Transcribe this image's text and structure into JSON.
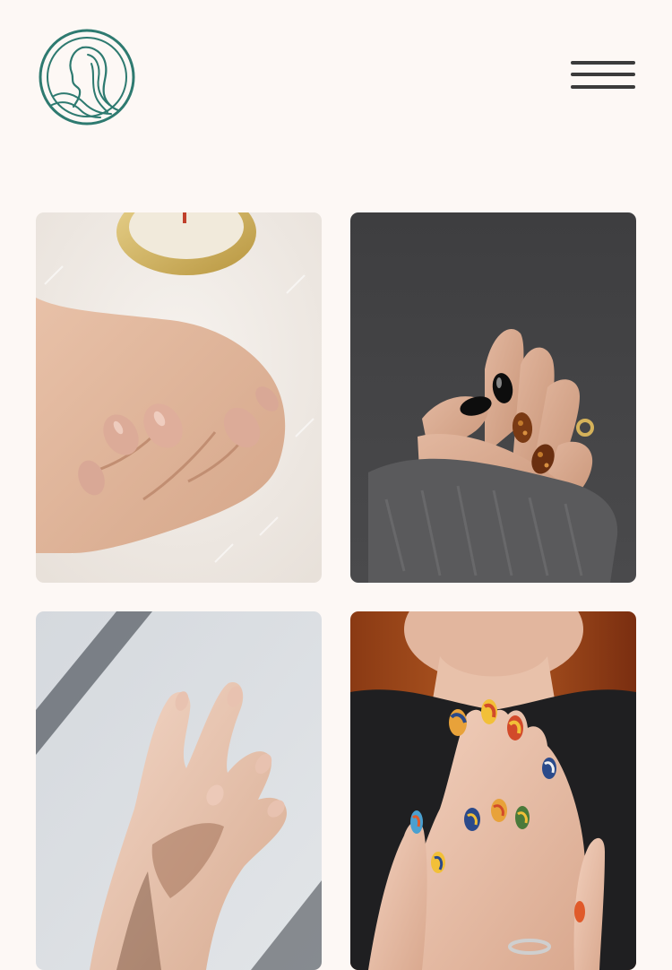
{
  "header": {
    "logo_icon": "woman-profile-circle-logo",
    "brand_color": "#2e7a70",
    "menu_icon": "hamburger-menu-icon",
    "menu_color": "#3b3b3b"
  },
  "page": {
    "background": "#fdf8f5"
  },
  "gallery": {
    "items": [
      {
        "subject": "nude-manicure-hand-on-fur",
        "nail_color": "#d9a896"
      },
      {
        "subject": "black-and-tortoiseshell-nails-grey-sweater",
        "nail_color": "#0d0d0d"
      },
      {
        "subject": "natural-nails-hand-in-sunlight",
        "nail_color": "#e8c2b0"
      },
      {
        "subject": "colorful-abstract-nail-art-praying-hands",
        "nail_color": "#e8a23a"
      }
    ]
  }
}
